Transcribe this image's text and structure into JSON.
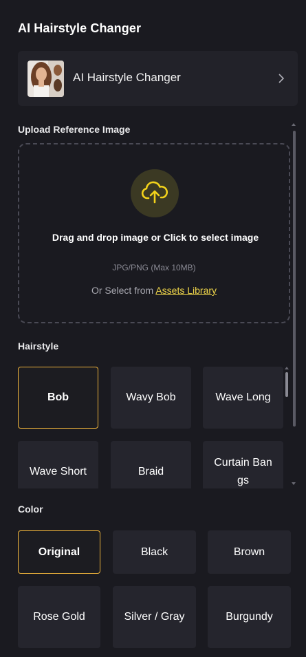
{
  "panel": {
    "title": "AI Hairstyle Changer"
  },
  "tool_card": {
    "name": "AI Hairstyle Changer",
    "thumb_icon": "portrait-thumbnail",
    "chevron_icon": "chevron-right-icon"
  },
  "upload": {
    "section_label": "Upload Reference Image",
    "icon": "cloud-upload-icon",
    "main_text": "Drag and drop image or Click to select image",
    "hint": "JPG/PNG (Max 10MB)",
    "assets_prefix": "Or Select from ",
    "assets_link": "Assets Library"
  },
  "hairstyle": {
    "section_label": "Hairstyle",
    "selected": "Bob",
    "items": [
      {
        "label": "Bob",
        "selected": true
      },
      {
        "label": "Wavy Bob",
        "selected": false
      },
      {
        "label": "Wave Long",
        "selected": false
      },
      {
        "label": "Wave Short",
        "selected": false
      },
      {
        "label": "Braid",
        "selected": false
      },
      {
        "label": "Curtain Bangs",
        "selected": false
      }
    ]
  },
  "color": {
    "section_label": "Color",
    "selected": "Original",
    "items": [
      {
        "label": "Original",
        "selected": true
      },
      {
        "label": "Black",
        "selected": false
      },
      {
        "label": "Brown",
        "selected": false
      },
      {
        "label": "Rose Gold",
        "selected": false
      },
      {
        "label": "Silver / Gray",
        "selected": false
      },
      {
        "label": "Burgundy",
        "selected": false
      }
    ]
  },
  "colors": {
    "accent": "#f0b43c",
    "link": "#f0d64a",
    "background": "#1a1a20",
    "card": "#222229",
    "tile": "#25252d"
  }
}
